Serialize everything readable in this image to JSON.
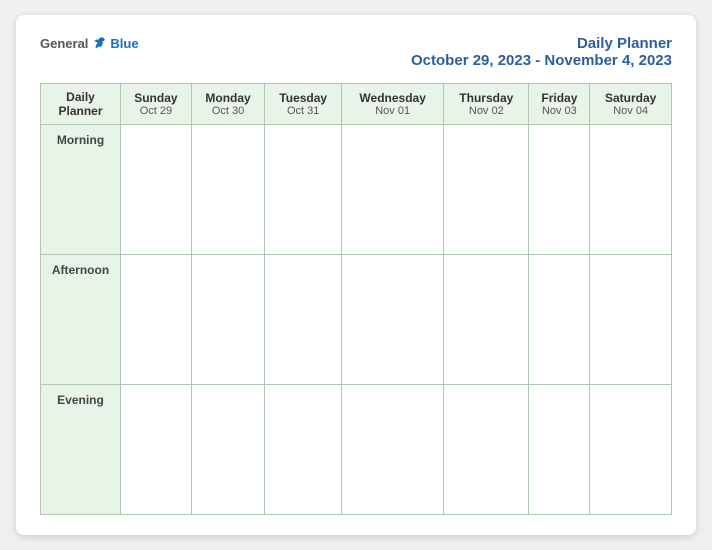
{
  "logo": {
    "general": "General",
    "blue": "Blue"
  },
  "title": {
    "line1": "Daily Planner",
    "line2": "October 29, 2023 - November 4, 2023"
  },
  "header_label": {
    "line1": "Daily",
    "line2": "Planner"
  },
  "columns": [
    {
      "day": "Sunday",
      "date": "Oct 29"
    },
    {
      "day": "Monday",
      "date": "Oct 30"
    },
    {
      "day": "Tuesday",
      "date": "Oct 31"
    },
    {
      "day": "Wednesday",
      "date": "Nov 01"
    },
    {
      "day": "Thursday",
      "date": "Nov 02"
    },
    {
      "day": "Friday",
      "date": "Nov 03"
    },
    {
      "day": "Saturday",
      "date": "Nov 04"
    }
  ],
  "rows": [
    {
      "label": "Morning"
    },
    {
      "label": "Afternoon"
    },
    {
      "label": "Evening"
    }
  ]
}
